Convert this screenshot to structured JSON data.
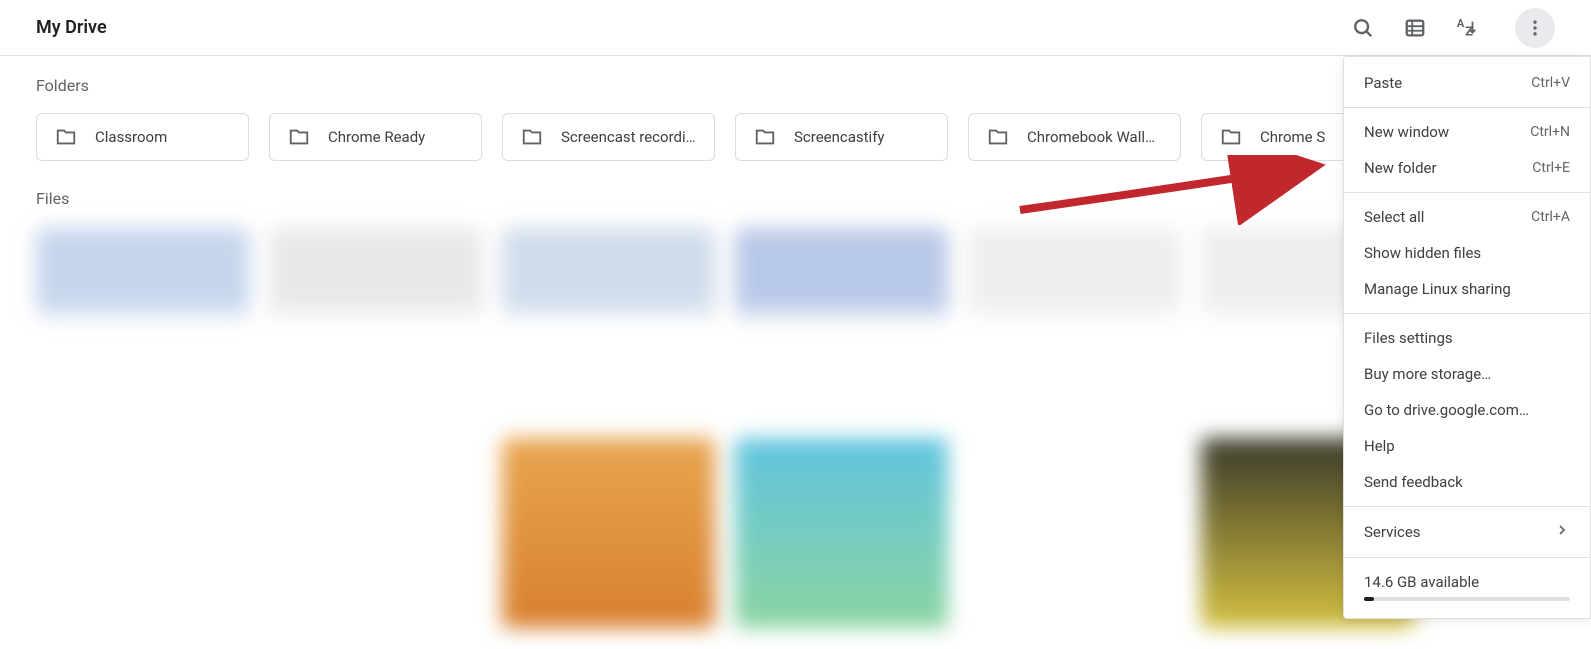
{
  "header": {
    "title": "My Drive"
  },
  "sections": {
    "folders_label": "Folders",
    "files_label": "Files"
  },
  "folders": [
    {
      "name": "Classroom"
    },
    {
      "name": "Chrome Ready"
    },
    {
      "name": "Screencast recordin…"
    },
    {
      "name": "Screencastify"
    },
    {
      "name": "Chromebook Wallp…"
    },
    {
      "name": "Chrome S"
    }
  ],
  "menu": {
    "paste": {
      "label": "Paste",
      "shortcut": "Ctrl+V"
    },
    "new_window": {
      "label": "New window",
      "shortcut": "Ctrl+N"
    },
    "new_folder": {
      "label": "New folder",
      "shortcut": "Ctrl+E"
    },
    "select_all": {
      "label": "Select all",
      "shortcut": "Ctrl+A"
    },
    "show_hidden": {
      "label": "Show hidden files"
    },
    "manage_linux": {
      "label": "Manage Linux sharing"
    },
    "files_settings": {
      "label": "Files settings"
    },
    "buy_storage": {
      "label": "Buy more storage…"
    },
    "goto_drive": {
      "label": "Go to drive.google.com…"
    },
    "help": {
      "label": "Help"
    },
    "feedback": {
      "label": "Send feedback"
    },
    "services": {
      "label": "Services"
    },
    "storage": {
      "label": "14.6 GB available"
    }
  }
}
